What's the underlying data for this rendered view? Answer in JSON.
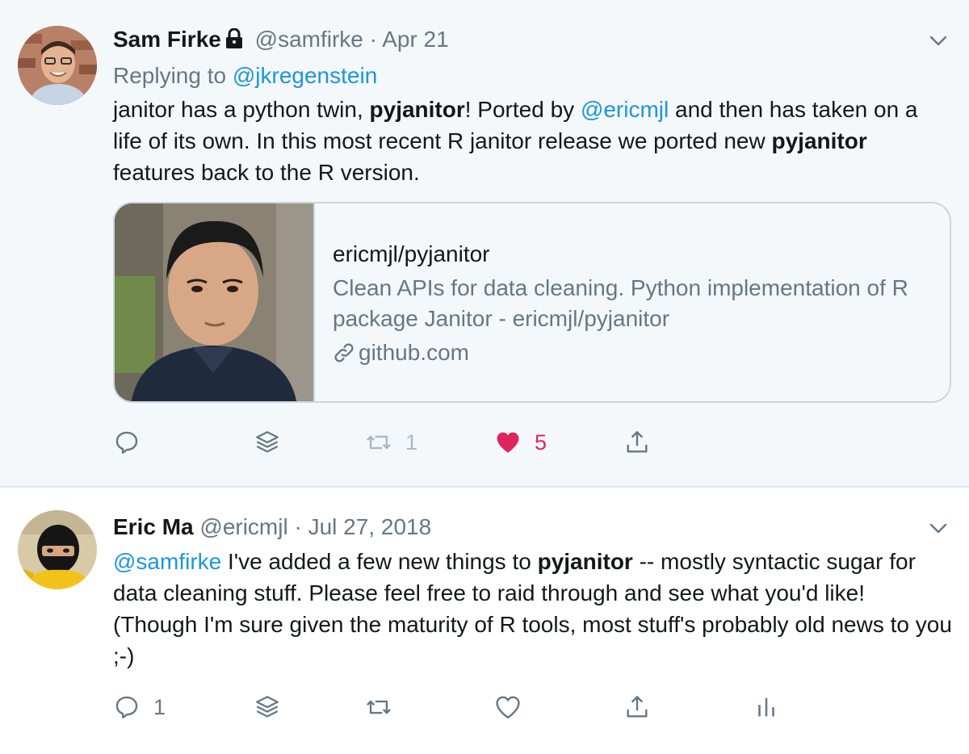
{
  "tweets": [
    {
      "author": {
        "name": "Sam Firke",
        "handle": "@samfirke",
        "locked": true
      },
      "dot": "·",
      "date": "Apr 21",
      "replying": {
        "prefix": "Replying to ",
        "to": "@jkregenstein"
      },
      "text": {
        "p1": "janitor has a python twin, ",
        "b1": "pyjanitor",
        "p2": "!  Ported by ",
        "mention": "@ericmjl",
        "p3": " and then has taken on a life of its own.  In this most recent R janitor release we ported new ",
        "b2": "pyjanitor",
        "p4": " features back to the R version."
      },
      "card": {
        "title": "ericmjl/pyjanitor",
        "description": "Clean APIs for data cleaning. Python implementation of R package Janitor - ericmjl/pyjanitor",
        "domain": "github.com",
        "icon": "link-icon"
      },
      "actions": {
        "replies": "",
        "retweets": "1",
        "likes": "5",
        "liked": true
      },
      "background": "#f5f8fa"
    },
    {
      "author": {
        "name": "Eric Ma",
        "handle": "@ericmjl",
        "locked": false
      },
      "dot": "·",
      "date": "Jul 27, 2018",
      "text": {
        "mention": "@samfirke",
        "p1": " I've added a few new things to ",
        "b1": "pyjanitor",
        "p2": " -- mostly syntactic sugar for data cleaning stuff. Please feel free to raid through and see what you'd like! (Though I'm sure given the maturity of R tools, most stuff's probably old news to you ;-)"
      },
      "actions": {
        "replies": "1",
        "retweets": "",
        "likes": "",
        "liked": false
      },
      "background": "#ffffff"
    }
  ],
  "colors": {
    "link": "#1b95e0",
    "muted": "#657786",
    "like": "#e0245e",
    "border": "#e1e8ed"
  }
}
